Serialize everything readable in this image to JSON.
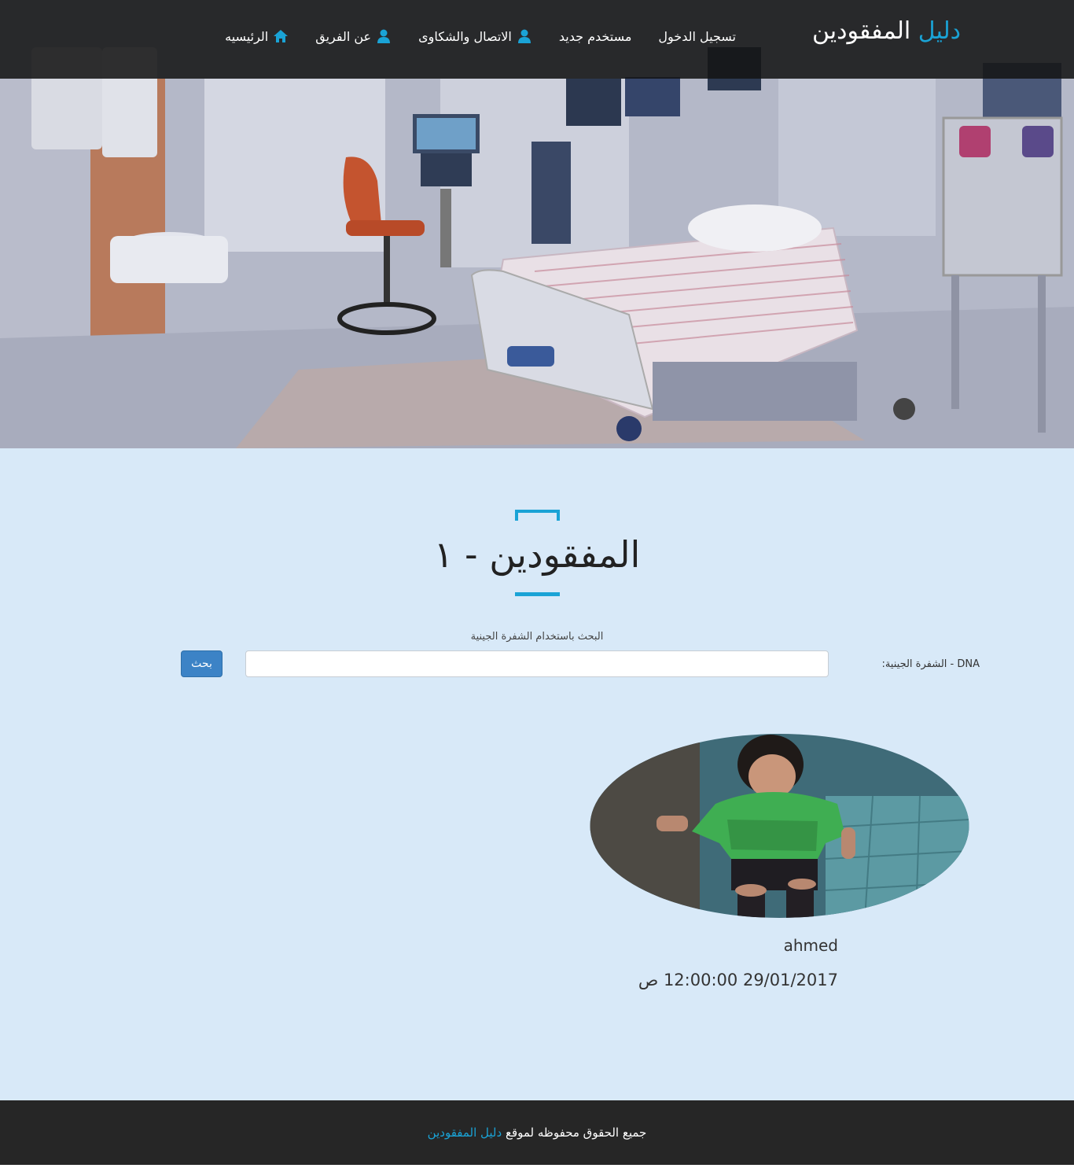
{
  "navbar": {
    "brand_main": "دليل",
    "brand_rest": "المفقودين",
    "items": [
      {
        "label": "الرئيسيه",
        "icon": "home-icon"
      },
      {
        "label": "عن الفريق",
        "icon": "user-icon"
      },
      {
        "label": "الاتصال والشكاوى",
        "icon": "user-icon"
      },
      {
        "label": "مستخدم جديد",
        "icon": ""
      },
      {
        "label": "تسجيل الدخول",
        "icon": ""
      }
    ]
  },
  "hero": {
    "image": "hospital-room-photo"
  },
  "main": {
    "title": "المفقودين - ١",
    "search": {
      "caption": "البحث باستخدام الشفرة الجينية",
      "label": "DNA - الشفرة الجينية:",
      "input_value": "",
      "button_label": "بحث"
    },
    "results": [
      {
        "photo": "missing-child-photo",
        "name": "ahmed",
        "date": "29/01/2017 12:00:00 ص"
      }
    ]
  },
  "footer": {
    "text": "جميع الحقوق محفوظه لموقع",
    "site_name": "دليل المفقودين"
  },
  "colors": {
    "accent": "#1aa3d6",
    "navbar_bg": "#1e1e1e",
    "main_bg": "#d8e9f8",
    "footer_bg": "#262626",
    "button": "#3c83c6"
  }
}
